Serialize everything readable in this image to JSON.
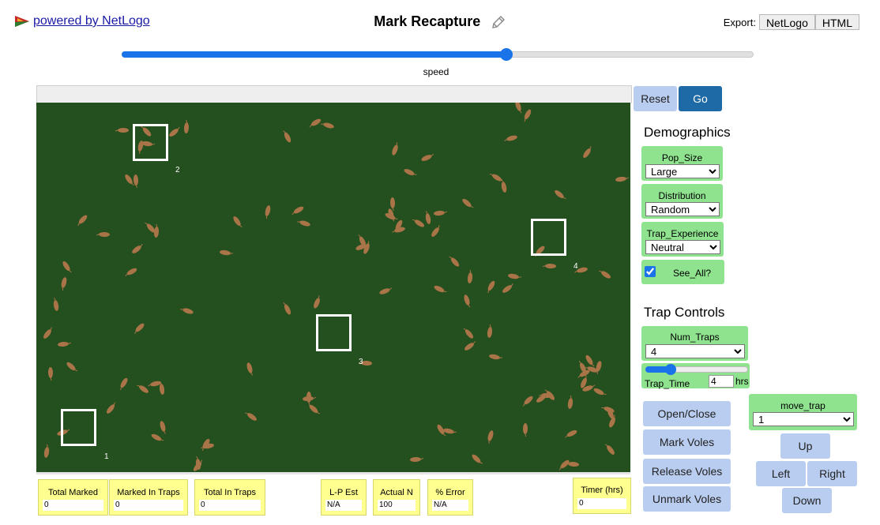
{
  "header": {
    "powered_by": "powered by NetLogo",
    "title": "Mark Recapture",
    "export_label": "Export:",
    "export_netlogo": "NetLogo",
    "export_html": "HTML"
  },
  "speed": {
    "label": "speed",
    "value": 0.61
  },
  "world": {
    "background": "#244f1f",
    "vole_color": "#a97447",
    "trap_labels": [
      "1",
      "2",
      "3",
      "4"
    ]
  },
  "controls": {
    "reset": "Reset",
    "go": "Go",
    "demographics_title": "Demographics",
    "pop_size": {
      "label": "Pop_Size",
      "value": "Large"
    },
    "distribution": {
      "label": "Distribution",
      "value": "Random"
    },
    "trap_experience": {
      "label": "Trap_Experience",
      "value": "Neutral"
    },
    "see_all": {
      "label": "See_All?",
      "checked": true
    },
    "trap_controls_title": "Trap Controls",
    "num_traps": {
      "label": "Num_Traps",
      "value": "4"
    },
    "trap_time": {
      "label": "Trap_Time",
      "value": "4",
      "units": "hrs",
      "level": 0.25
    },
    "open_close": "Open/Close",
    "mark_voles": "Mark Voles",
    "release_voles": "Release Voles",
    "unmark_voles": "Unmark Voles",
    "move_trap": {
      "label": "move_trap",
      "value": "1"
    },
    "up": "Up",
    "left": "Left",
    "right": "Right",
    "down": "Down"
  },
  "monitors": {
    "total_marked": {
      "label": "Total Marked",
      "value": "0"
    },
    "marked_in_traps": {
      "label": "Marked In Traps",
      "value": "0"
    },
    "total_in_traps": {
      "label": "Total In Traps",
      "value": "0"
    },
    "lp_est": {
      "label": "L-P Est",
      "value": "N/A"
    },
    "actual_n": {
      "label": "Actual N",
      "value": "100"
    },
    "pct_error": {
      "label": "% Error",
      "value": "N/A"
    },
    "timer": {
      "label": "Timer (hrs)",
      "value": "0"
    }
  },
  "colors": {
    "accent": "#1a73e8",
    "button": "#b9cdf0",
    "go_button": "#1e6aa6",
    "widget": "#8fe38f",
    "monitor": "#ffff8f"
  }
}
